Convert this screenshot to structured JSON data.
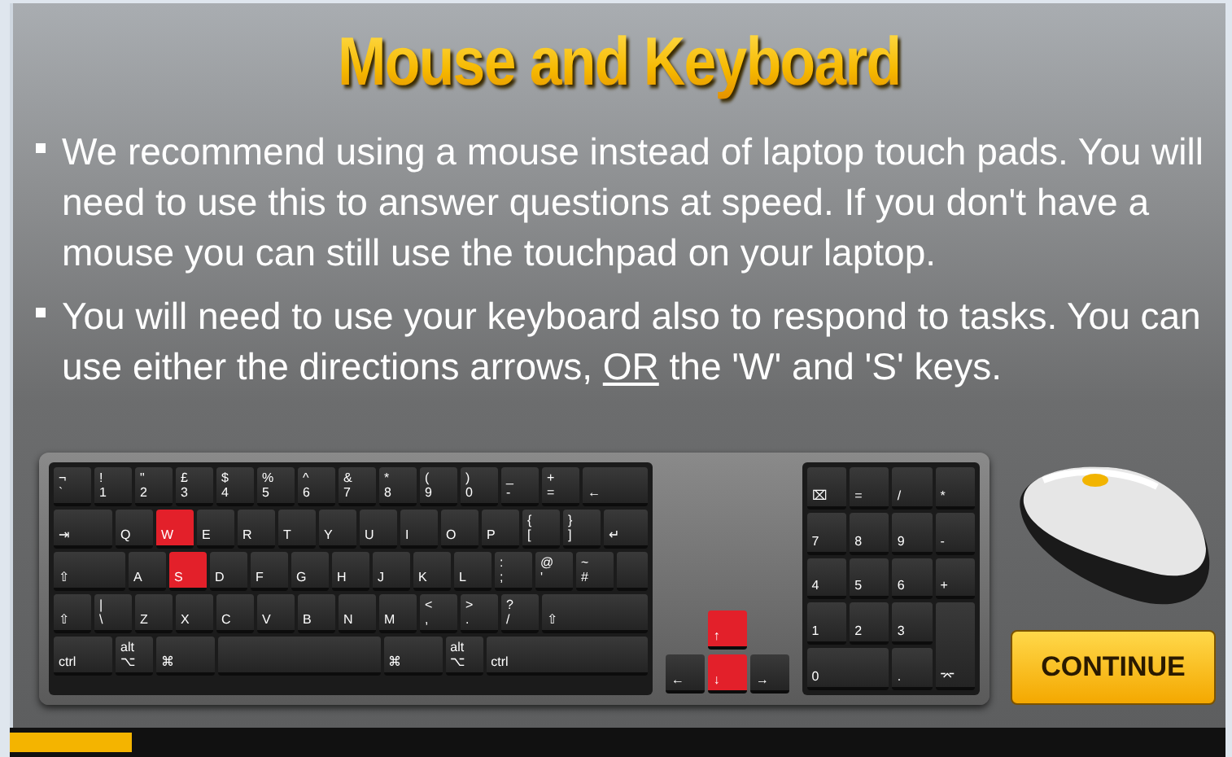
{
  "title": "Mouse and Keyboard",
  "bullets": [
    {
      "segments": [
        {
          "text": "We recommend using a mouse instead of laptop touch pads. You will need to use this to answer questions at speed. If you don't have a mouse you can still use the touchpad on your laptop.",
          "underline": false
        }
      ]
    },
    {
      "segments": [
        {
          "text": "You will need to use your keyboard also to respond to tasks. You can use either the directions arrows, ",
          "underline": false
        },
        {
          "text": "OR",
          "underline": true
        },
        {
          "text": " the 'W' and 'S' keys.",
          "underline": false
        }
      ]
    }
  ],
  "keyboard": {
    "main_rows": [
      [
        {
          "kind": "key",
          "top": "¬",
          "label": "`",
          "highlighted": false
        },
        {
          "kind": "key",
          "top": "!",
          "label": "1",
          "highlighted": false
        },
        {
          "kind": "key",
          "top": "\"",
          "label": "2",
          "highlighted": false
        },
        {
          "kind": "key",
          "top": "£",
          "label": "3",
          "highlighted": false
        },
        {
          "kind": "key",
          "top": "$",
          "label": "4",
          "highlighted": false
        },
        {
          "kind": "key",
          "top": "%",
          "label": "5",
          "highlighted": false
        },
        {
          "kind": "key",
          "top": "^",
          "label": "6",
          "highlighted": false
        },
        {
          "kind": "key",
          "top": "&",
          "label": "7",
          "highlighted": false
        },
        {
          "kind": "key",
          "top": "*",
          "label": "8",
          "highlighted": false
        },
        {
          "kind": "key",
          "top": "(",
          "label": "9",
          "highlighted": false
        },
        {
          "kind": "key",
          "top": ")",
          "label": "0",
          "highlighted": false
        },
        {
          "kind": "key",
          "top": "_",
          "label": "-",
          "highlighted": false
        },
        {
          "kind": "key",
          "top": "+",
          "label": "=",
          "highlighted": false
        },
        {
          "kind": "wide",
          "label": "←",
          "highlighted": false
        }
      ],
      [
        {
          "kind": "tab",
          "label": "⇥",
          "highlighted": false
        },
        {
          "kind": "key",
          "label": "Q",
          "highlighted": false
        },
        {
          "kind": "key",
          "label": "W",
          "highlighted": true
        },
        {
          "kind": "key",
          "label": "E",
          "highlighted": false
        },
        {
          "kind": "key",
          "label": "R",
          "highlighted": false
        },
        {
          "kind": "key",
          "label": "T",
          "highlighted": false
        },
        {
          "kind": "key",
          "label": "Y",
          "highlighted": false
        },
        {
          "kind": "key",
          "label": "U",
          "highlighted": false
        },
        {
          "kind": "key",
          "label": "I",
          "highlighted": false
        },
        {
          "kind": "key",
          "label": "O",
          "highlighted": false
        },
        {
          "kind": "key",
          "label": "P",
          "highlighted": false
        },
        {
          "kind": "key",
          "top": "{",
          "label": "[",
          "highlighted": false
        },
        {
          "kind": "key",
          "top": "}",
          "label": "]",
          "highlighted": false
        },
        {
          "kind": "wide",
          "label": "↵",
          "highlighted": false
        }
      ],
      [
        {
          "kind": "caps",
          "label": "⇧",
          "highlighted": false
        },
        {
          "kind": "key",
          "label": "A",
          "highlighted": false
        },
        {
          "kind": "key",
          "label": "S",
          "highlighted": true
        },
        {
          "kind": "key",
          "label": "D",
          "highlighted": false
        },
        {
          "kind": "key",
          "label": "F",
          "highlighted": false
        },
        {
          "kind": "key",
          "label": "G",
          "highlighted": false
        },
        {
          "kind": "key",
          "label": "H",
          "highlighted": false
        },
        {
          "kind": "key",
          "label": "J",
          "highlighted": false
        },
        {
          "kind": "key",
          "label": "K",
          "highlighted": false
        },
        {
          "kind": "key",
          "label": "L",
          "highlighted": false
        },
        {
          "kind": "key",
          "top": ":",
          "label": ";",
          "highlighted": false
        },
        {
          "kind": "key",
          "top": "@",
          "label": "'",
          "highlighted": false
        },
        {
          "kind": "key",
          "top": "~",
          "label": "#",
          "highlighted": false
        },
        {
          "kind": "wide",
          "highlighted": false
        }
      ],
      [
        {
          "kind": "key",
          "label": "⇧",
          "highlighted": false
        },
        {
          "kind": "key",
          "top": "|",
          "label": "\\",
          "highlighted": false
        },
        {
          "kind": "key",
          "label": "Z",
          "highlighted": false
        },
        {
          "kind": "key",
          "label": "X",
          "highlighted": false
        },
        {
          "kind": "key",
          "label": "C",
          "highlighted": false
        },
        {
          "kind": "key",
          "label": "V",
          "highlighted": false
        },
        {
          "kind": "key",
          "label": "B",
          "highlighted": false
        },
        {
          "kind": "key",
          "label": "N",
          "highlighted": false
        },
        {
          "kind": "key",
          "label": "M",
          "highlighted": false
        },
        {
          "kind": "key",
          "top": "<",
          "label": ",",
          "highlighted": false
        },
        {
          "kind": "key",
          "top": ">",
          "label": ".",
          "highlighted": false
        },
        {
          "kind": "key",
          "top": "?",
          "label": "/",
          "highlighted": false
        },
        {
          "kind": "wide",
          "label": "⇧",
          "highlighted": false
        }
      ],
      [
        {
          "kind": "mod",
          "label": "ctrl",
          "highlighted": false
        },
        {
          "kind": "key",
          "top": "alt",
          "label": "⌥",
          "highlighted": false
        },
        {
          "kind": "mod",
          "label": "⌘",
          "highlighted": false
        },
        {
          "kind": "space",
          "highlighted": false
        },
        {
          "kind": "mod",
          "label": "⌘",
          "highlighted": false
        },
        {
          "kind": "key",
          "top": "alt",
          "label": "⌥",
          "highlighted": false
        },
        {
          "kind": "wide",
          "label": "ctrl",
          "highlighted": false
        }
      ]
    ],
    "arrows": [
      {
        "kind": "up",
        "label": "↑",
        "highlighted": true
      },
      {
        "kind": "left",
        "label": "←",
        "highlighted": false
      },
      {
        "kind": "down",
        "label": "↓",
        "highlighted": true
      },
      {
        "kind": "right",
        "label": "→",
        "highlighted": false
      }
    ],
    "numpad": [
      {
        "kind": "key",
        "label": "⌧"
      },
      {
        "kind": "key",
        "label": "="
      },
      {
        "kind": "key",
        "label": "/"
      },
      {
        "kind": "key",
        "label": "*"
      },
      {
        "kind": "key",
        "label": "7"
      },
      {
        "kind": "key",
        "label": "8"
      },
      {
        "kind": "key",
        "label": "9"
      },
      {
        "kind": "key",
        "label": "-"
      },
      {
        "kind": "key",
        "label": "4"
      },
      {
        "kind": "key",
        "label": "5"
      },
      {
        "kind": "key",
        "label": "6"
      },
      {
        "kind": "key",
        "label": "+"
      },
      {
        "kind": "key",
        "label": "1"
      },
      {
        "kind": "key",
        "label": "2"
      },
      {
        "kind": "key",
        "label": "3"
      },
      {
        "kind": "zero",
        "label": "0"
      },
      {
        "kind": "key",
        "label": "."
      },
      {
        "kind": "tall",
        "label": "⌤"
      }
    ]
  },
  "continue_button": "CONTINUE",
  "progress": {
    "level": 0.1
  }
}
